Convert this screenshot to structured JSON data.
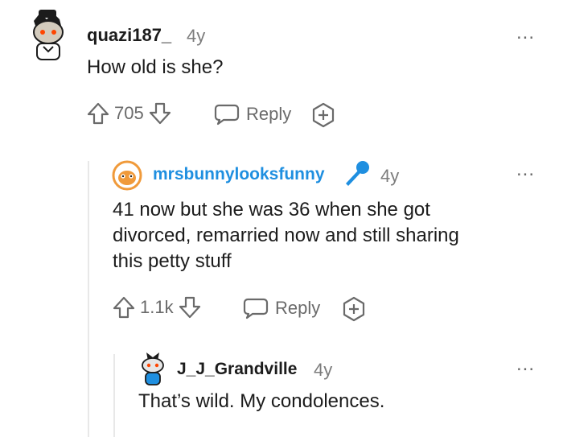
{
  "comments": [
    {
      "username": "quazi187_",
      "age": "4y",
      "text": "How old is she?",
      "votes": "705",
      "reply_label": "Reply",
      "more_label": "..."
    },
    {
      "username": "mrsbunnylooksfunny",
      "age": "4y",
      "text_lines": [
        "41 now but she was 36 when she got",
        "divorced, remarried now and still sharing",
        "this petty stuff"
      ],
      "votes": "1.1k",
      "reply_label": "Reply",
      "more_label": "...",
      "flair_icon": "microphone-icon"
    },
    {
      "username": "J_J_Grandville",
      "age": "4y",
      "text": "That’s wild. My condolences.",
      "more_label": "..."
    }
  ],
  "colors": {
    "username_link": "#1f8fe0",
    "muted": "#7c7c7c",
    "thread_line": "#e8e8e8",
    "avatar_orange": "#ff4500"
  }
}
